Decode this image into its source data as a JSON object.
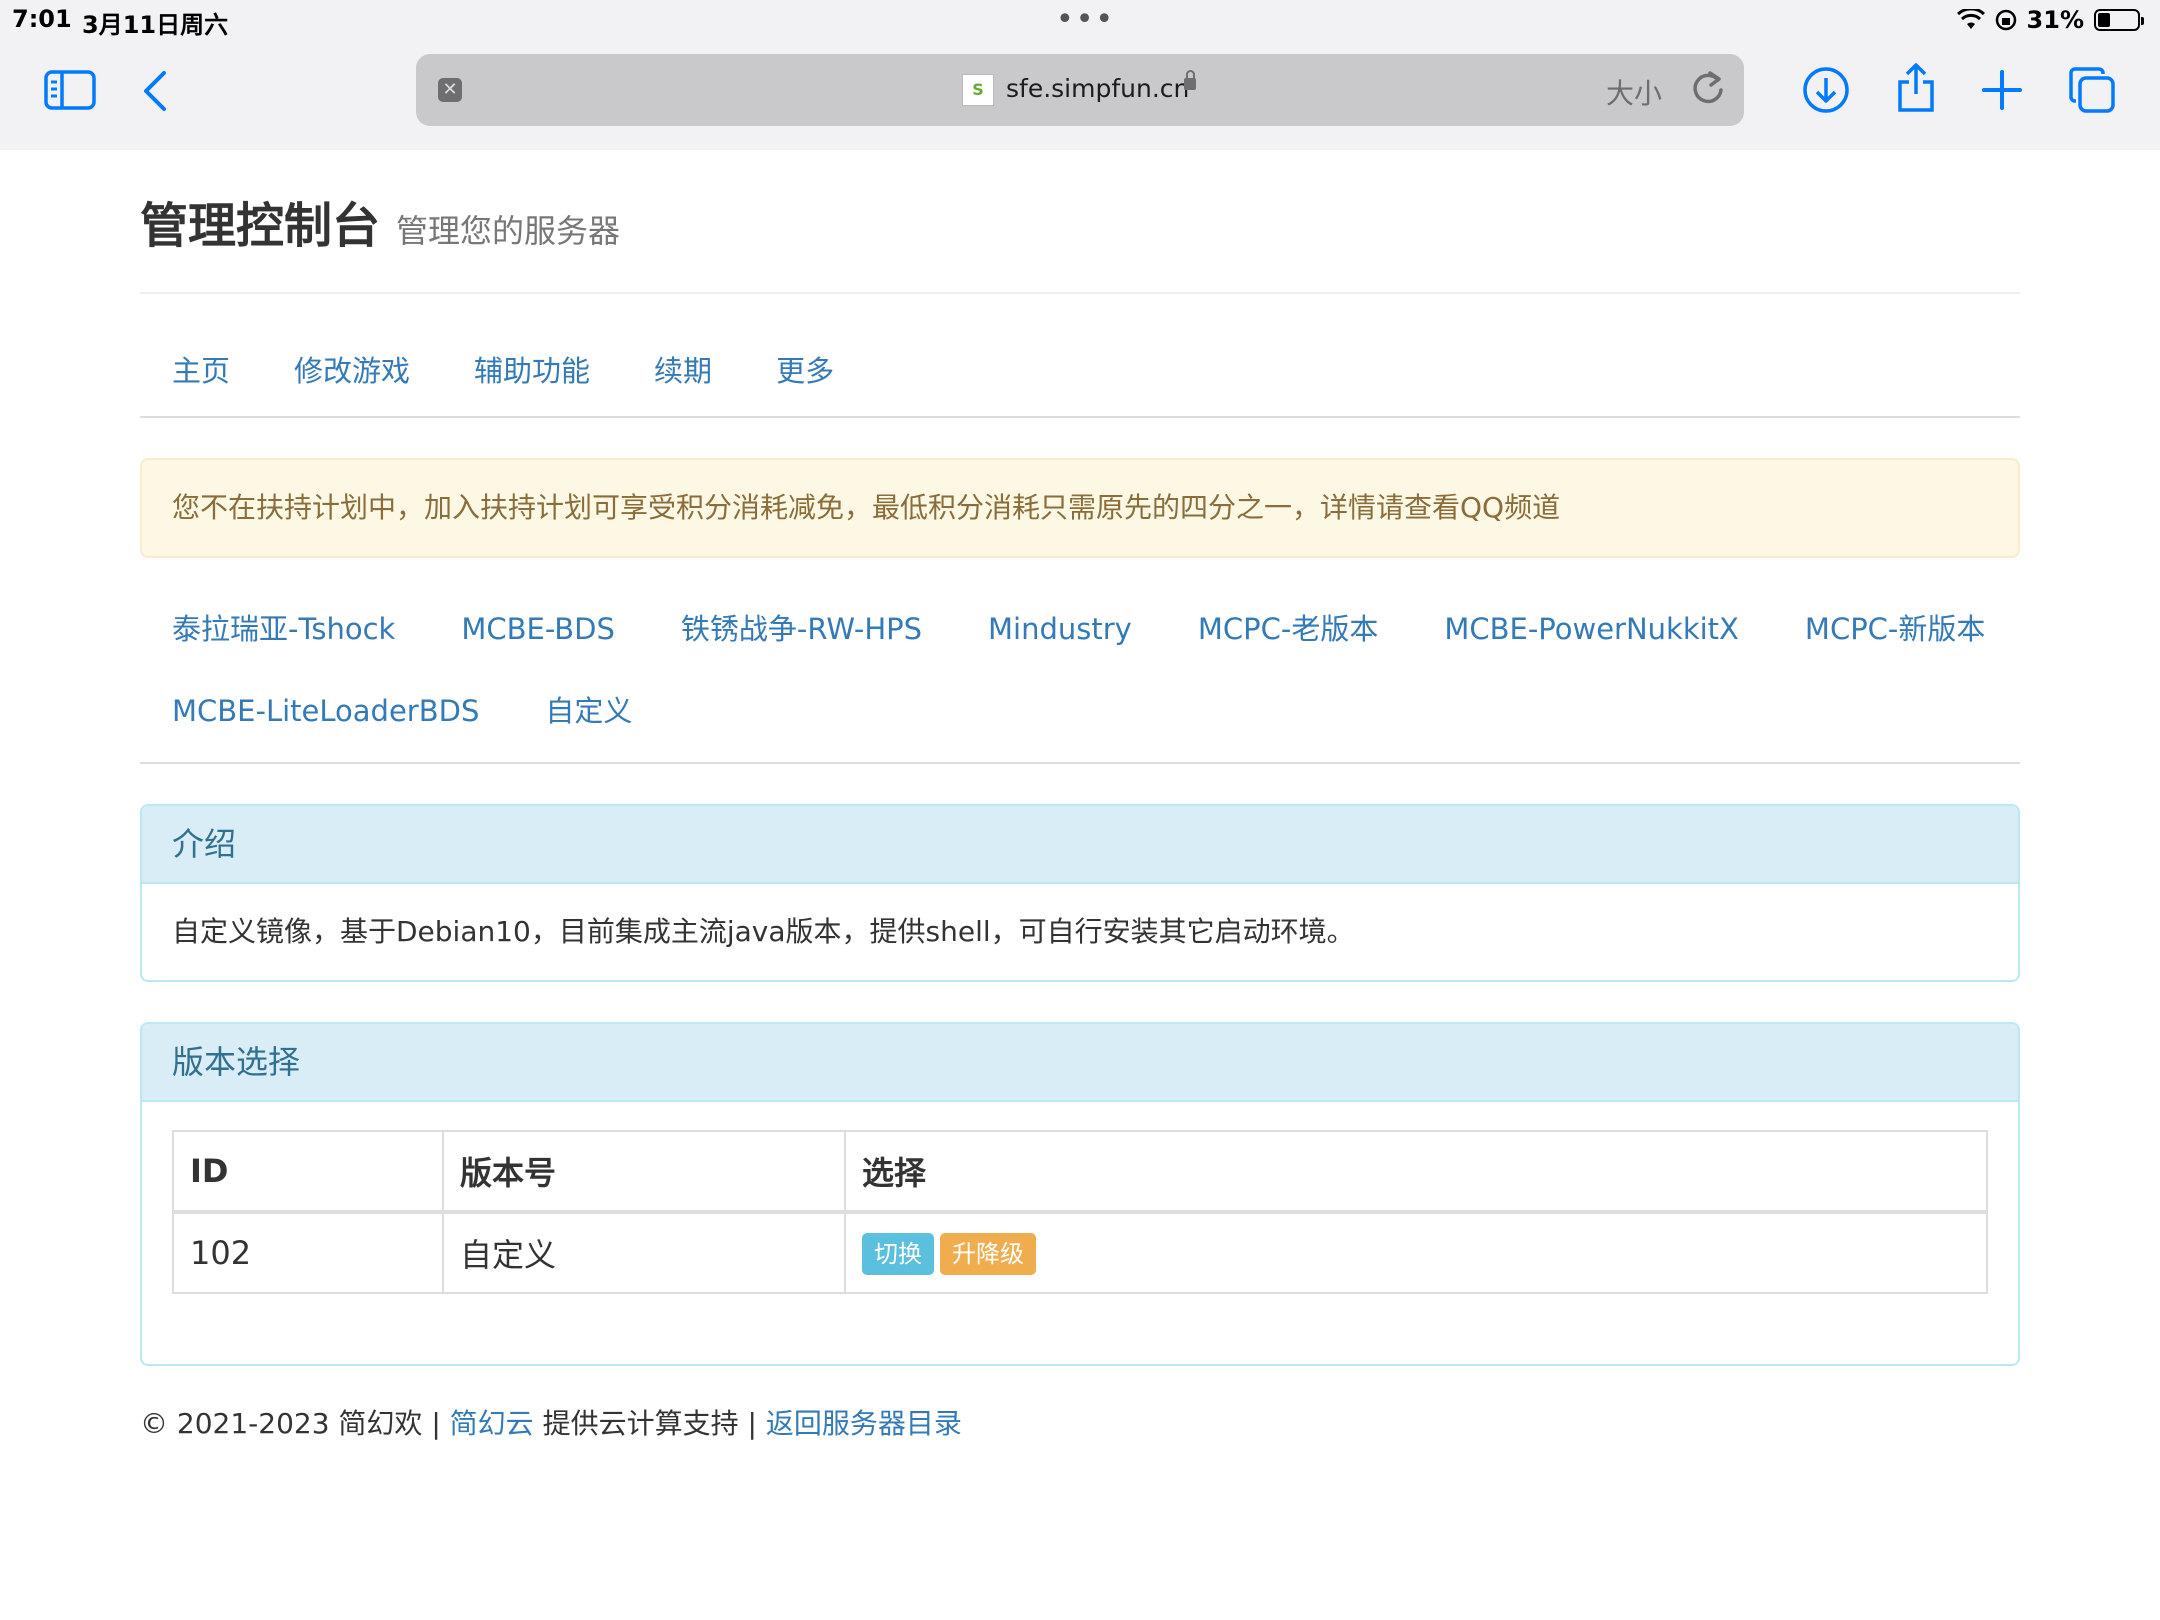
{
  "status": {
    "time": "7:01",
    "date": "3月11日周六",
    "battery_text": "31%",
    "battery_level": 0.31
  },
  "browser": {
    "url": "sfe.simpfun.cn",
    "text_size_label": "大小",
    "favicon_text": "S"
  },
  "header": {
    "title": "管理控制台",
    "subtitle": "管理您的服务器"
  },
  "nav": [
    "主页",
    "修改游戏",
    "辅助功能",
    "续期",
    "更多"
  ],
  "alert": "您不在扶持计划中，加入扶持计划可享受积分消耗减免，最低积分消耗只需原先的四分之一，详情请查看QQ频道",
  "games": [
    "泰拉瑞亚-Tshock",
    "MCBE-BDS",
    "铁锈战争-RW-HPS",
    "Mindustry",
    "MCPC-老版本",
    "MCBE-PowerNukkitX",
    "MCPC-新版本",
    "MCBE-LiteLoaderBDS",
    "自定义"
  ],
  "intro": {
    "heading": "介绍",
    "body": "自定义镜像，基于Debian10，目前集成主流java版本，提供shell，可自行安装其它启动环境。"
  },
  "versions": {
    "heading": "版本选择",
    "columns": [
      "ID",
      "版本号",
      "选择"
    ],
    "rows": [
      {
        "id": "102",
        "version": "自定义",
        "switch_label": "切换",
        "upgrade_label": "升降级"
      }
    ]
  },
  "footer": {
    "copyright": "© 2021-2023 简幻欢 |",
    "link1": "简幻云",
    "middle": "提供云计算支持 |",
    "link2": "返回服务器目录"
  },
  "colors": {
    "link": "#337ab7",
    "alert_bg": "#fcf8e3",
    "panel_heading_bg": "#d9edf7",
    "label_info": "#5bc0de",
    "label_warning": "#f0ad4e",
    "safari_blue": "#007aff"
  }
}
